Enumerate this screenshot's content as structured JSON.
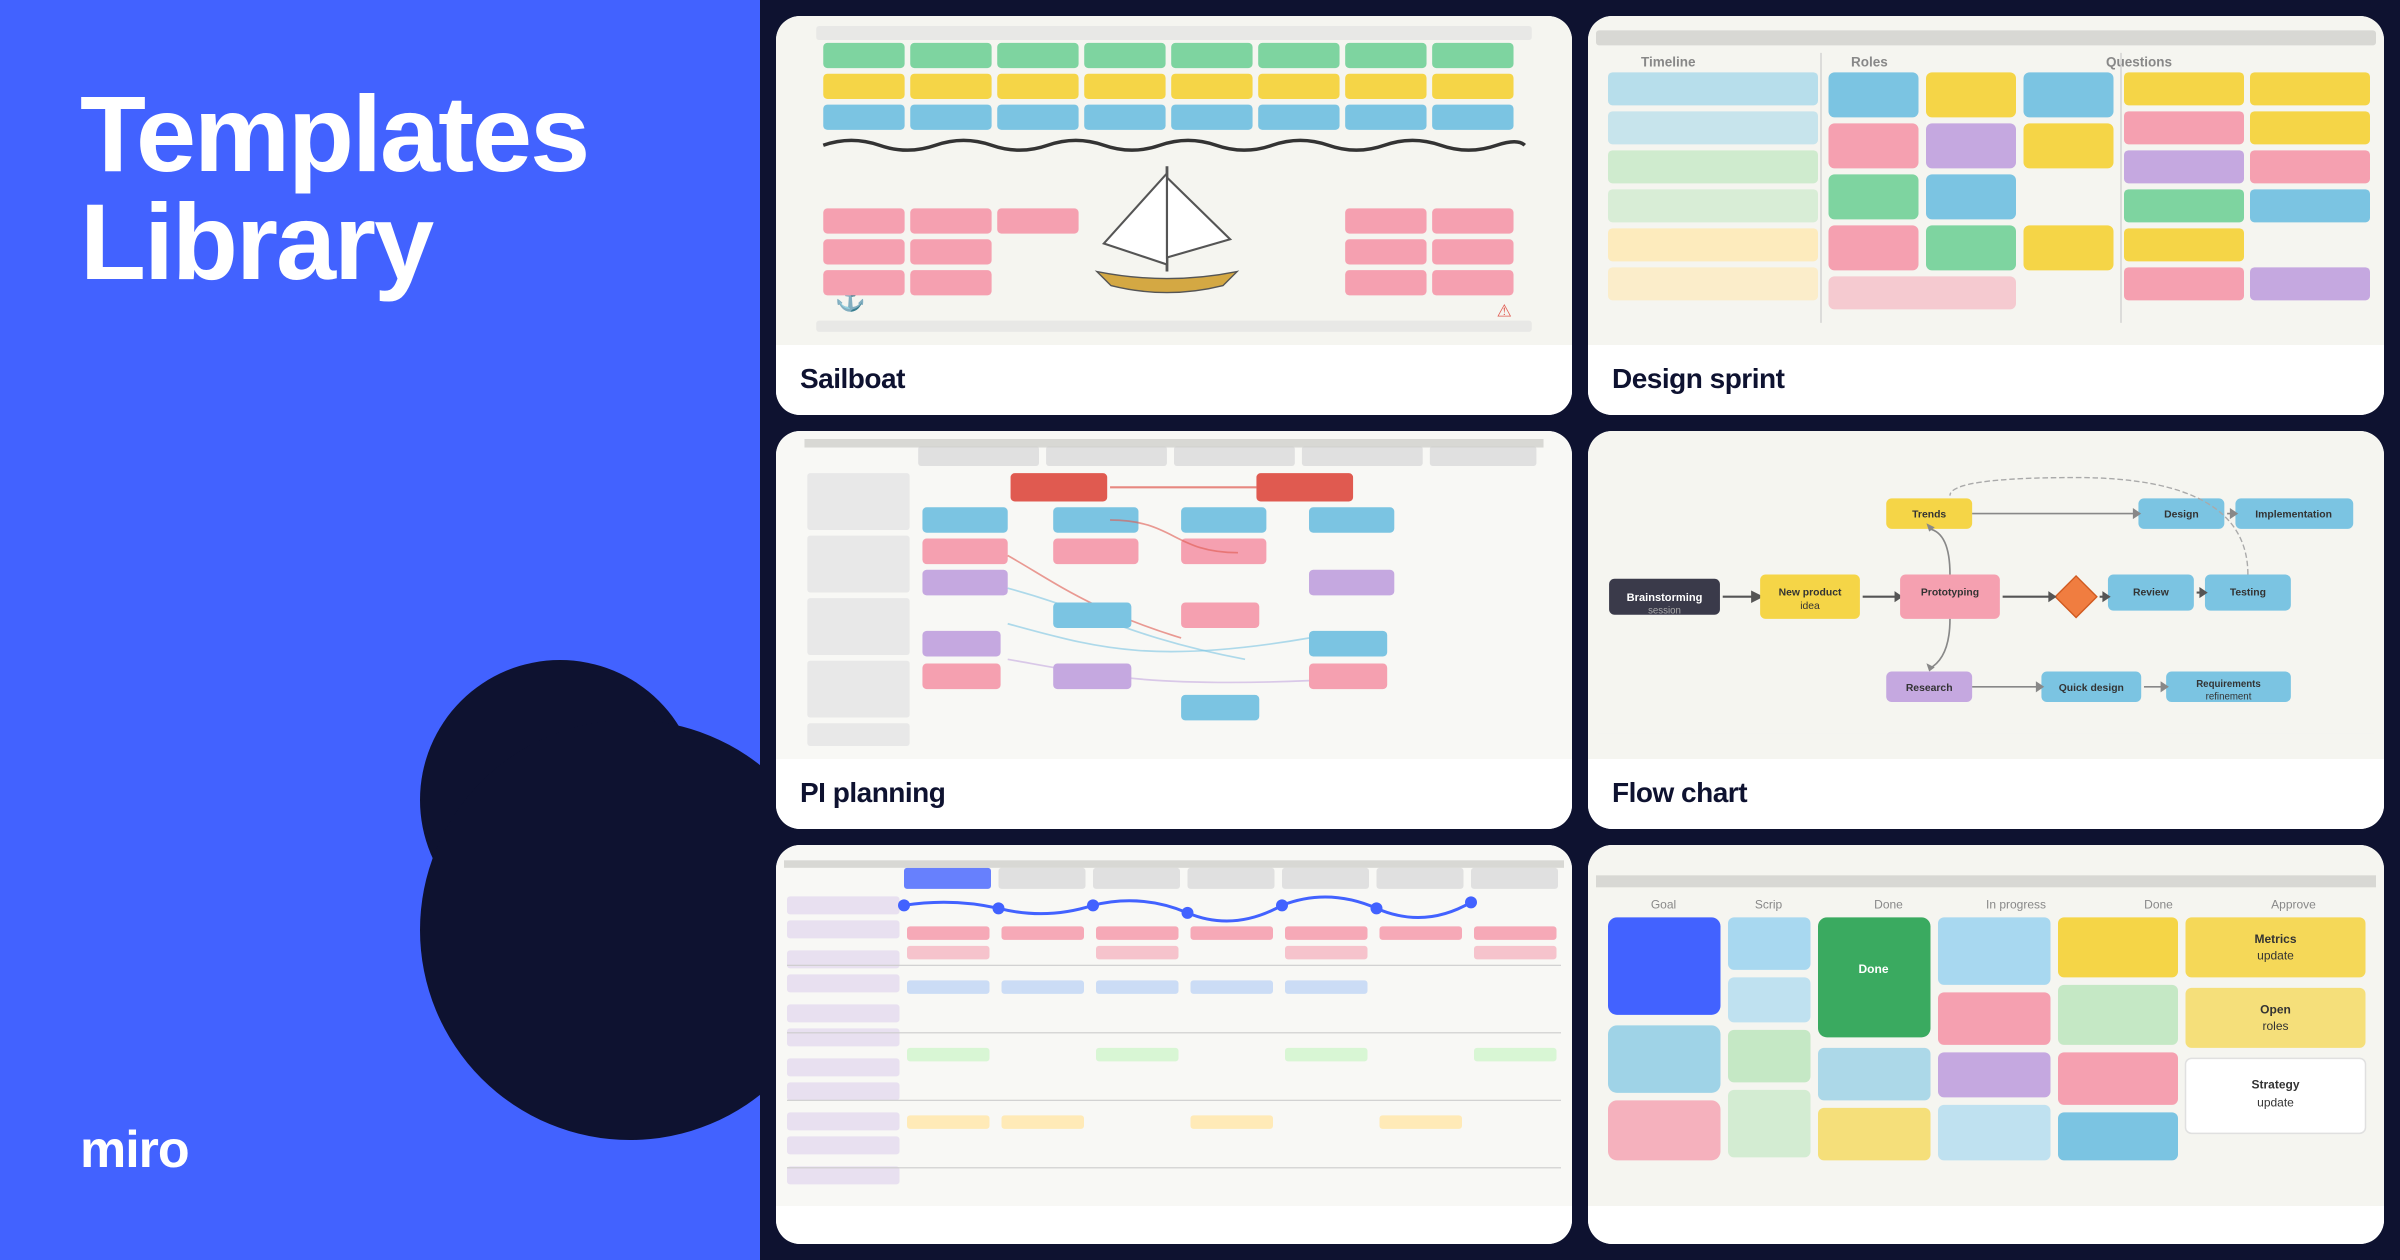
{
  "left": {
    "title_line1": "Templates",
    "title_line2": "Library",
    "logo_text": "miro"
  },
  "cards": {
    "sailboat": {
      "title": "Sailboat",
      "preview_bg": "#f5f5f0"
    },
    "pi_planning": {
      "title": "PI planning",
      "preview_bg": "#f8f8f5"
    },
    "design_sprint": {
      "title": "Design sprint",
      "preview_bg": "#f5f5f0"
    },
    "flow_chart": {
      "title": "Flow chart",
      "preview_bg": "#f5f5f0"
    },
    "bottom_left": {
      "title": "",
      "preview_bg": "#f8f8f5"
    },
    "bottom_right": {
      "title": "",
      "preview_bg": "#f5f5f0"
    }
  }
}
